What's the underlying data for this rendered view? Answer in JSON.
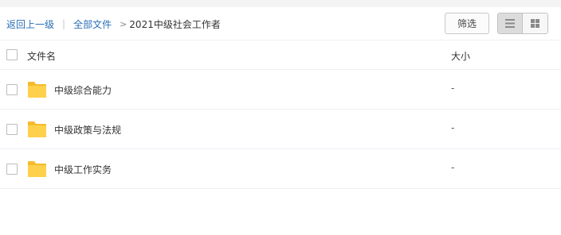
{
  "breadcrumb": {
    "back": "返回上一级",
    "separator": "|",
    "all_files": "全部文件",
    "chevron": ">",
    "current": "2021中级社会工作者"
  },
  "toolbar": {
    "filter_label": "筛选",
    "view_list_icon": "list-view-icon",
    "view_grid_icon": "grid-view-icon",
    "active_view": "list"
  },
  "table": {
    "columns": {
      "name": "文件名",
      "size": "大小"
    },
    "rows": [
      {
        "name": "中级综合能力",
        "size": "-",
        "type": "folder"
      },
      {
        "name": "中级政策与法规",
        "size": "-",
        "type": "folder"
      },
      {
        "name": "中级工作实务",
        "size": "-",
        "type": "folder"
      }
    ]
  },
  "colors": {
    "link": "#2a6fb6",
    "folder": "#ffd04b",
    "folder_tab": "#f5bb2c",
    "divider": "#eef0f4"
  }
}
